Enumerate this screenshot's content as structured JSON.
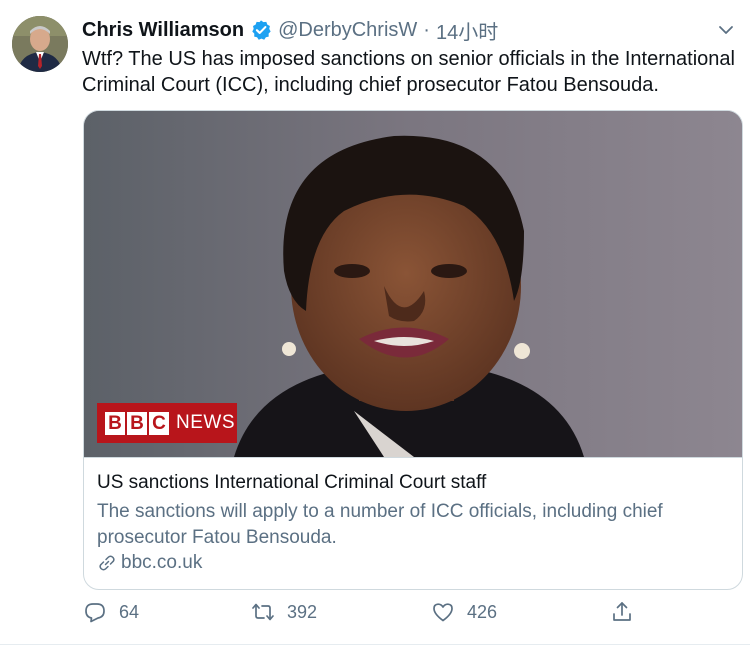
{
  "author": {
    "name": "Chris Williamson",
    "handle": "@DerbyChrisW",
    "separator": "·",
    "time": "14小时",
    "verified": true,
    "avatar_icon": "user-avatar"
  },
  "tweet": {
    "text": "Wtf? The US has imposed sanctions on senior officials in the International Criminal Court (ICC), including chief prosecutor Fatou Bensouda."
  },
  "card": {
    "image_icon": "news-photo",
    "logo": {
      "box_letters": [
        "B",
        "B",
        "C"
      ],
      "word": "NEWS"
    },
    "title": "US sanctions International Criminal Court staff",
    "description": "The sanctions will apply to a number of ICC officials, including chief prosecutor Fatou Bensouda.",
    "link_icon": "link-icon",
    "domain": "bbc.co.uk"
  },
  "actions": {
    "reply": {
      "icon": "reply-icon",
      "count": "64"
    },
    "retweet": {
      "icon": "retweet-icon",
      "count": "392"
    },
    "like": {
      "icon": "heart-icon",
      "count": "426"
    },
    "share": {
      "icon": "share-icon",
      "count": ""
    }
  },
  "colors": {
    "verified_blue": "#1da1f2",
    "bbc_red": "#b8151b",
    "secondary_text": "#5b7083",
    "border": "#cfd9de"
  }
}
